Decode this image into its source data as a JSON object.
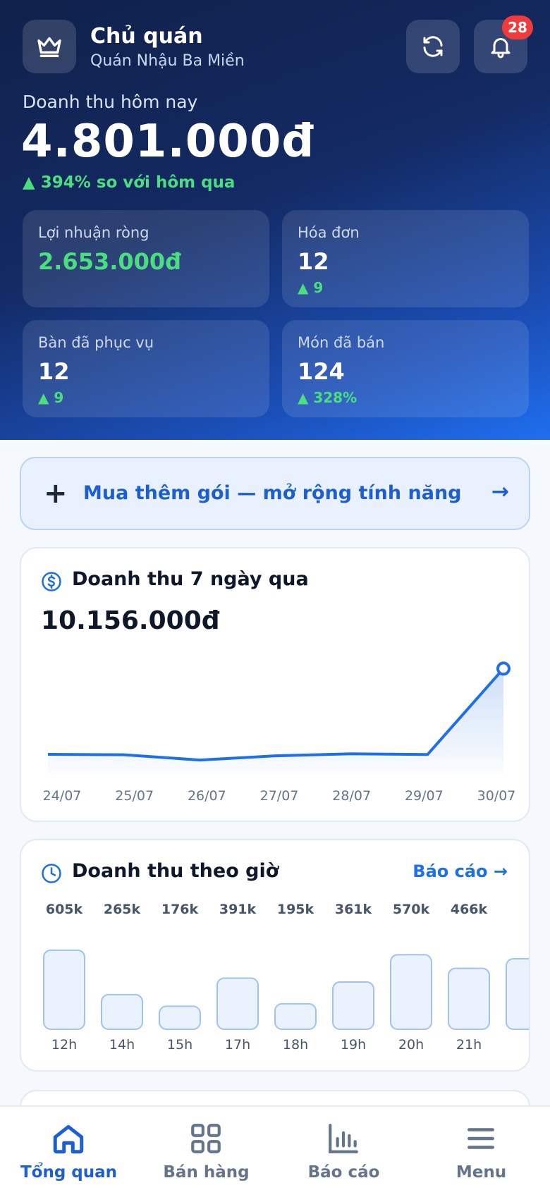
{
  "header": {
    "role": "Chủ quán",
    "shop_name": "Quán Nhậu Ba Miền",
    "notification_count": "28",
    "icons": [
      "crown-icon",
      "refresh-icon",
      "bell-icon"
    ]
  },
  "revenue_today": {
    "label": "Doanh thu hôm nay",
    "value": "4.801.000đ",
    "growth": "▲ 394% so với hôm qua"
  },
  "stats": [
    {
      "label": "Lợi nhuận ròng",
      "value": "2.653.000đ",
      "delta": ""
    },
    {
      "label": "Hóa đơn",
      "value": "12",
      "delta": "▲ 9"
    },
    {
      "label": "Bàn đã phục vụ",
      "value": "12",
      "delta": "▲ 9"
    },
    {
      "label": "Món đã bán",
      "value": "124",
      "delta": "▲ 328%"
    }
  ],
  "promo": {
    "plus": "+",
    "text": "Mua thêm gói — mở rộng tính năng",
    "arrow": "→"
  },
  "weekly_card": {
    "title": "Doanh thu 7 ngày qua",
    "total": "10.156.000đ"
  },
  "hourly_card": {
    "title": "Doanh thu theo giờ",
    "link": "Báo cáo →"
  },
  "chart_data": [
    {
      "type": "area",
      "title": "Doanh thu 7 ngày qua",
      "categories": [
        "24/07",
        "25/07",
        "26/07",
        "27/07",
        "28/07",
        "29/07",
        "30/07"
      ],
      "values": [
        900000,
        880000,
        640000,
        830000,
        920000,
        890000,
        4801000
      ],
      "ylim": [
        0,
        5200000
      ],
      "grid": false,
      "color": "#1f6fe5"
    },
    {
      "type": "bar",
      "title": "Doanh thu theo giờ",
      "categories": [
        "12h",
        "14h",
        "15h",
        "17h",
        "18h",
        "19h",
        "20h",
        "21h"
      ],
      "values": [
        605000,
        265000,
        176000,
        391000,
        195000,
        361000,
        570000,
        466000
      ],
      "labels": [
        "605k",
        "265k",
        "176k",
        "391k",
        "195k",
        "361k",
        "570k",
        "466k"
      ],
      "ylim": [
        0,
        700000
      ],
      "color": "#eaf2fe",
      "border": "#9ec3f3"
    }
  ],
  "nav": [
    {
      "label": "Tổng quan",
      "icon": "home-icon",
      "active": true
    },
    {
      "label": "Bán hàng",
      "icon": "grid-icon",
      "active": false
    },
    {
      "label": "Báo cáo",
      "icon": "bar-chart-icon",
      "active": false
    },
    {
      "label": "Menu",
      "icon": "menu-icon",
      "active": false
    }
  ]
}
